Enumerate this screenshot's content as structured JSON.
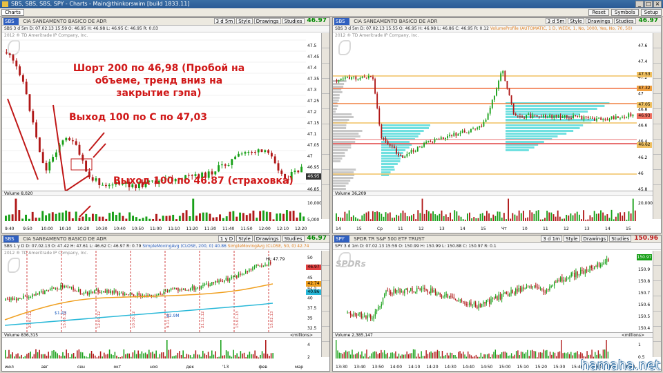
{
  "window": {
    "title": "SBS, SBS, SBS, SPY - Charts - Main@thinkorswim [build 1833.11]",
    "buttons": [
      "_",
      "□",
      "×"
    ]
  },
  "toolbar": {
    "tab": "Charts",
    "right_buttons": [
      "Reset",
      "Symbols",
      "Setup"
    ]
  },
  "panel_tl": {
    "symbol": "SBS",
    "description": "CIA SANEAMENTO BASICO DE ADR",
    "period": "3 d 5m",
    "style": "Style",
    "drawings": "Drawings",
    "studies": "Studies",
    "last": "46.97",
    "quote": "SBS 3 d 5m  D: 07.02.13 15:59  O: 46.95  H: 46.98  L: 46.95  C: 46.95  R: 0.03",
    "copyright": "2012 ® TD Ameritrade IP Company, Inc.",
    "volume_label": "Volume",
    "volume_value": "8,020",
    "y_ticks": [
      "47.5",
      "47.45",
      "47.4",
      "47.35",
      "47.3",
      "47.25",
      "47.2",
      "47.15",
      "47.1",
      "47.05",
      "47",
      "46.95",
      "46.9",
      "46.85"
    ],
    "vol_ticks": [
      "10,000",
      "5,000"
    ],
    "x_ticks": [
      "9:40",
      "9:50",
      "10:00",
      "10:10",
      "10:20",
      "10:30",
      "10:40",
      "10:50",
      "11:00",
      "11:10",
      "11:20",
      "11:30",
      "11:40",
      "11:50",
      "12:00",
      "12:10",
      "12:20"
    ],
    "last_tag": "46.95"
  },
  "panel_tr": {
    "symbol": "SBS",
    "description": "CIA SANEAMENTO BASICO DE ADR",
    "period": "3 d 5m",
    "style": "Style",
    "drawings": "Drawings",
    "studies": "Studies",
    "last": "46.97",
    "quote": "SBS 3 d 5m  D: 07.02.13 15:55  O: 46.95  H: 46.98  L: 46.86  C: 46.95  R: 0.12",
    "indicator": "VolumeProfile (AUTOMATIC, 1 D, WEEK, 1, No, 1000, Yes, No, 70, 50)",
    "copyright": "2012 ® TD Ameritrade IP Company, Inc.",
    "volume_label": "Volume",
    "volume_value": "36,209",
    "y_ticks": [
      "47.6",
      "47.4",
      "47.2",
      "47",
      "46.8",
      "46.6",
      "46.4",
      "46.2",
      "46",
      "45.8"
    ],
    "price_tags": [
      "47.53",
      "47.32",
      "47.05",
      "46.93",
      "46.62"
    ],
    "vol_ticks": [
      "20,000"
    ],
    "x_ticks": [
      "14",
      "15",
      "Ср",
      "11",
      "12",
      "13",
      "14",
      "15",
      "Чт",
      "10",
      "11",
      "12",
      "13",
      "14",
      "15"
    ]
  },
  "panel_bl": {
    "symbol": "SBS",
    "description": "CIA SANEAMENTO BASICO DE ADR",
    "period": "1 y D",
    "style": "Style",
    "drawings": "Drawings",
    "studies": "Studies",
    "last": "46.97",
    "quote": "SBS 1 y D  D: 07.02.13  O: 47.42  H: 47.61  L: 46.62  C: 46.97  R: 0.79",
    "ind1": "SimpleMovingAvg (CLOSE, 200, 0)",
    "ind1_val": "40.86",
    "ind2": "SimpleMovingAvg (CLOSE, 50, 0)",
    "ind2_val": "42.74",
    "copyright": "2012 ® TD Ameritrade IP Company, Inc.",
    "hi_label": "Hi: 47.79",
    "y_ticks": [
      "50",
      "47.5",
      "45",
      "42.5",
      "40",
      "37.5",
      "35",
      "32.5"
    ],
    "price_tags": [
      "46.97",
      "42.74",
      "40.86"
    ],
    "vlines": [
      "20.07.12",
      "15.08.12",
      "12.09.12",
      "10.10.12",
      "9.11.12",
      "21.12.12",
      "15.01.13",
      "15.02.13"
    ],
    "callouts": [
      "$1.43",
      "$2.9M"
    ],
    "volume_label": "Volume",
    "volume_value": "836,315",
    "millions": "<millions>",
    "vol_ticks": [
      "4",
      "2"
    ],
    "x_ticks": [
      "июл",
      "авг",
      "сен",
      "окт",
      "ноя",
      "дек",
      "'13",
      "фев",
      "мар"
    ]
  },
  "panel_br": {
    "symbol": "SPY",
    "description": "SPDR TR S&P 500 ETF TRUST",
    "period": "3 d 1m",
    "style": "Style",
    "drawings": "Drawings",
    "studies": "Studies",
    "last": "150.96",
    "quote": "SPY 3 d 1m  D: 07.02.13 15:59  O: 150.99  H: 150.99  L: 150.88  C: 150.97  R: 0.1",
    "brand": "SPDRs",
    "y_ticks": [
      "151",
      "150.9",
      "150.8",
      "150.7",
      "150.6",
      "150.5",
      "150.4"
    ],
    "last_tag": "150.97",
    "volume_label": "Volume",
    "volume_value": "2,385,147",
    "millions": "<millions>",
    "vol_ticks": [
      "1",
      "0.5"
    ],
    "x_ticks": [
      "13:30",
      "13:40",
      "13:50",
      "14:00",
      "14:10",
      "14:20",
      "14:30",
      "14:40",
      "14:50",
      "15:00",
      "15:10",
      "15:20",
      "15:30",
      "15:40",
      "15:50",
      "Пт",
      "9:40"
    ]
  },
  "annotations": {
    "a1": "Шорт 200 по 46,98 (Пробой на объеме, тренд вниз на закрытие гэпа)",
    "a2": "Выход 100 по С по 47,03",
    "a3": "Выход 100 по 46.87 (страховка)"
  },
  "watermark": "hamaha.net",
  "colors": {
    "accent": "#d01818",
    "ma50": "#f0a020",
    "ma200": "#28b8d8",
    "up": "#18a018",
    "down": "#b01818"
  }
}
